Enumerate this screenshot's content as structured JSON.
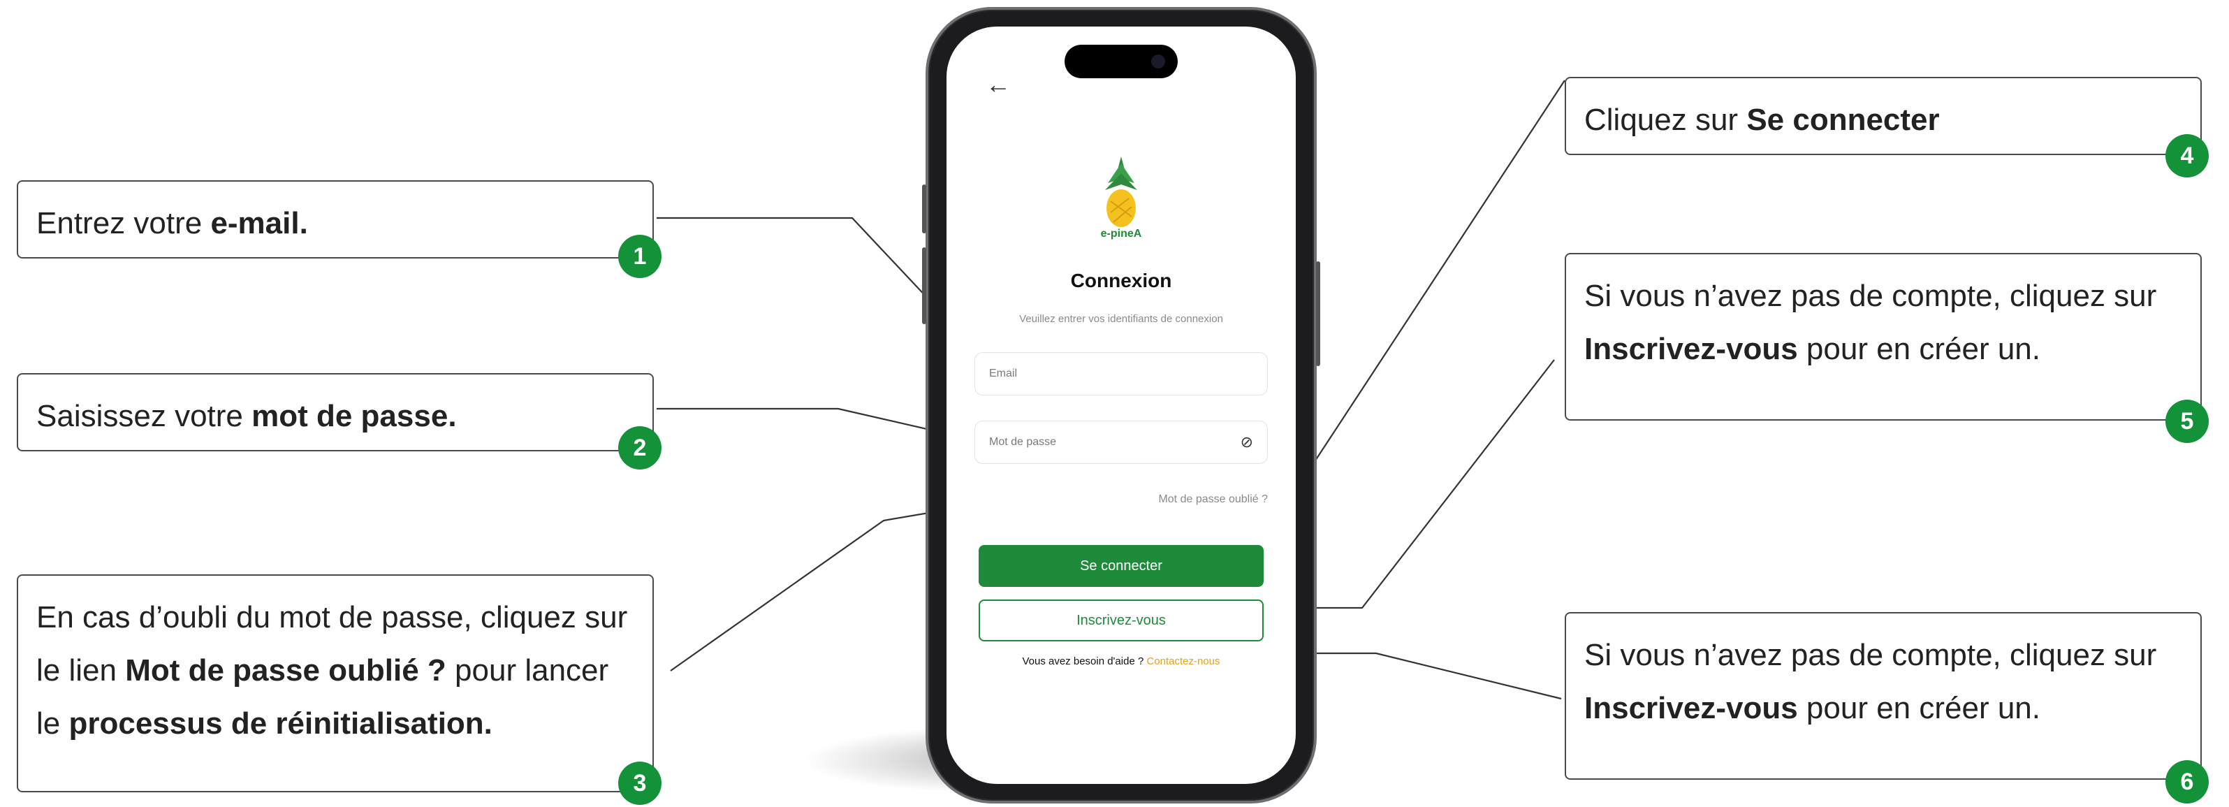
{
  "app": {
    "brand": "e-pineA",
    "title": "Connexion",
    "subtitle": "Veuillez entrer vos identifiants de connexion",
    "email_placeholder": "Email",
    "password_placeholder": "Mot de passe",
    "forgot_link": "Mot de passe oublié ?",
    "login_button": "Se connecter",
    "signup_button": "Inscrivez-vous",
    "help_text": "Vous avez besoin d'aide ?",
    "help_link": "Contactez-nous",
    "icons": {
      "back": "arrow-left-icon",
      "password_toggle": "eye-off-icon"
    }
  },
  "callouts": [
    {
      "number": "1",
      "pre": "Entrez votre ",
      "bold": "e-mail.",
      "mid": "",
      "bold2": "",
      "post": "",
      "bold3": ""
    },
    {
      "number": "2",
      "pre": "Saisissez votre ",
      "bold": "mot de passe.",
      "mid": "",
      "bold2": "",
      "post": "",
      "bold3": ""
    },
    {
      "number": "3",
      "pre": "En cas d’oubli du mot de passe, cliquez sur le lien ",
      "bold": "Mot de passe oublié ?",
      "mid": " pour lancer le ",
      "bold2": "processus de réinitialisation.",
      "post": "",
      "bold3": ""
    },
    {
      "number": "4",
      "pre": "Cliquez sur ",
      "bold": "Se connecter",
      "mid": "",
      "bold2": "",
      "post": "",
      "bold3": ""
    },
    {
      "number": "5",
      "pre": "Si vous n’avez pas de compte, cliquez sur ",
      "bold": "Inscrivez-vous",
      "mid": " pour en créer un.",
      "bold2": "",
      "post": "",
      "bold3": ""
    },
    {
      "number": "6",
      "pre": "Si vous n’avez pas de compte, cliquez sur ",
      "bold": "Inscrivez-vous",
      "mid": " pour en créer un.",
      "bold2": "",
      "post": "",
      "bold3": ""
    }
  ],
  "colors": {
    "accent": "#1f8a3a",
    "badge": "#14923a",
    "link": "#e3a317"
  }
}
